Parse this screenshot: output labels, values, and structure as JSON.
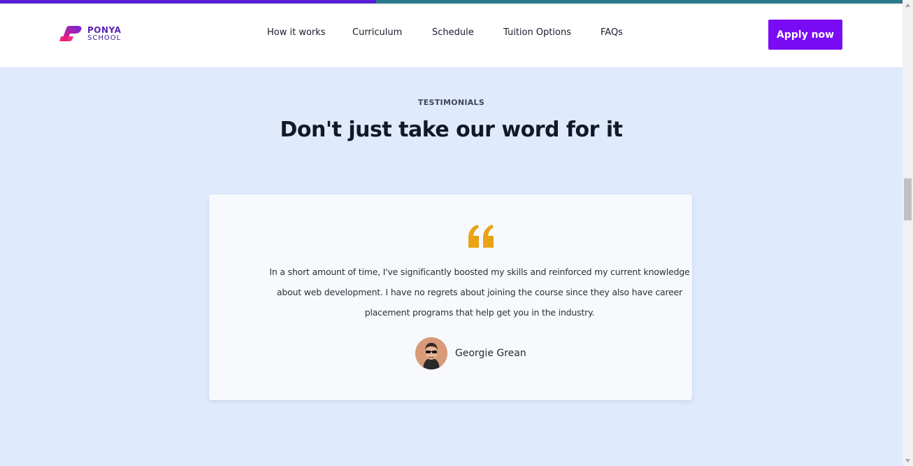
{
  "progress": {
    "fraction": 0.417,
    "fill_color": "#5b1ed8",
    "track_color": "#2b7a8c"
  },
  "header": {
    "logo": {
      "line1": "PONYA",
      "line2": "SCHOOL",
      "icon": "ponya-logo-icon"
    },
    "nav": [
      {
        "label": "How it works"
      },
      {
        "label": "Curriculum"
      },
      {
        "label": "Schedule"
      },
      {
        "label": "Tuition Options"
      },
      {
        "label": "FAQs"
      }
    ],
    "cta_label": "Apply now",
    "cta_color": "#7a0bf5"
  },
  "testimonials": {
    "eyebrow": "TESTIMONIALS",
    "heading": "Don't just take our word for it",
    "card": {
      "quote_icon": "quote-icon",
      "quote_color": "#e8a317",
      "text": "In a short amount of time, I've significantly boosted my skills and reinforced my current knowledge about web development. I have no regrets about joining the course since they also have career placement programs that help get you in the industry.",
      "author": "Georgie Grean"
    }
  },
  "colors": {
    "page_background": "#dfeafc",
    "card_background": "#f7f9fc"
  }
}
